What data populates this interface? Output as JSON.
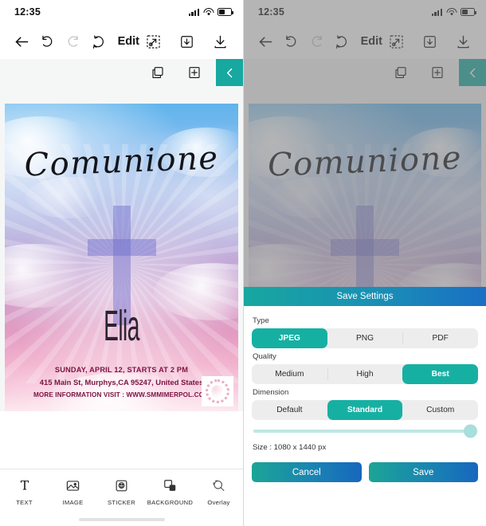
{
  "status_bar": {
    "time": "12:35",
    "icons": [
      "signal-icon",
      "wifi-icon",
      "battery-icon"
    ]
  },
  "toolbar": {
    "back_icon": "back-arrow-icon",
    "undo_icon": "undo-icon",
    "redo_icon": "redo-icon",
    "reset_icon": "reset-icon",
    "title": "Edit",
    "right_icons": [
      "crop-expand-icon",
      "save-to-device-icon",
      "download-icon"
    ]
  },
  "subbar": {
    "icons": [
      "layers-icon",
      "add-page-icon"
    ],
    "collapse_icon": "chevron-left-icon"
  },
  "poster": {
    "title": "Comunione",
    "name": "Elia",
    "line1": "SUNDAY, APRIL 12, STARTS AT 2 PM",
    "line2": "415 Main St, Murphys,CA 95247, United States",
    "line3": "MORE INFORMATION VISIT : WWW.SMMIMERPOL.COM",
    "sticker": "floral-wreath-sticker",
    "cross": "cross-graphic"
  },
  "bottom_tabs": [
    {
      "label": "TEXT",
      "icon": "text-icon"
    },
    {
      "label": "IMAGE",
      "icon": "image-icon"
    },
    {
      "label": "STICKER",
      "icon": "sticker-icon"
    },
    {
      "label": "BACKGROUND",
      "icon": "background-icon"
    },
    {
      "label": "Overlay",
      "icon": "overlay-icon"
    }
  ],
  "save_settings": {
    "header": "Save Settings",
    "type": {
      "label": "Type",
      "options": [
        "JPEG",
        "PNG",
        "PDF"
      ],
      "selected": "JPEG"
    },
    "quality": {
      "label": "Quality",
      "options": [
        "Medium",
        "High",
        "Best"
      ],
      "selected": "Best"
    },
    "dimension": {
      "label": "Dimension",
      "options": [
        "Default",
        "Standard",
        "Custom"
      ],
      "selected": "Standard"
    },
    "slider_value": 100,
    "size_text": "Size : 1080 x 1440 px",
    "cancel_label": "Cancel",
    "save_label": "Save"
  },
  "colors": {
    "accent_teal": "#16b0a3",
    "gradient_start": "#17a79f",
    "gradient_end": "#1a6fc4",
    "segment_bg": "#ededed",
    "slider_track": "#bfe6e4"
  }
}
